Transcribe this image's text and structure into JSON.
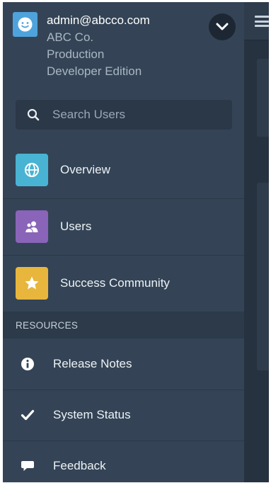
{
  "header": {
    "email": "admin@abcco.com",
    "org_name": "ABC Co.",
    "environment": "Production",
    "edition": "Developer Edition"
  },
  "search": {
    "placeholder": "Search Users"
  },
  "nav": [
    {
      "label": "Overview",
      "icon": "globe-icon",
      "color": "#49b3d3"
    },
    {
      "label": "Users",
      "icon": "users-icon",
      "color": "#8a64b8"
    },
    {
      "label": "Success Community",
      "icon": "star-icon",
      "color": "#e8b63c"
    }
  ],
  "resources": {
    "title": "RESOURCES",
    "items": [
      {
        "label": "Release Notes",
        "icon": "info-icon"
      },
      {
        "label": "System Status",
        "icon": "checkmark-icon"
      },
      {
        "label": "Feedback",
        "icon": "speech-bubble-icon"
      }
    ]
  }
}
